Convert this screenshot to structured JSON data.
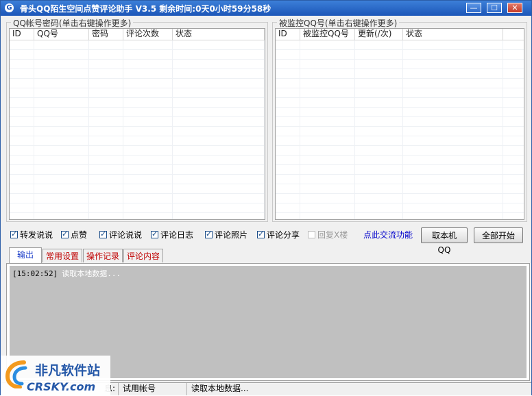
{
  "window": {
    "title": "骨头QQ陌生空间点赞评论助手 V3.5 剩余时间:0天0小时59分58秒",
    "controls": {
      "minimize": "—",
      "maximize": "☐",
      "close": "✕"
    }
  },
  "left_panel": {
    "label": "QQ帐号密码(单击右键操作更多)",
    "columns": [
      "ID",
      "QQ号",
      "密码",
      "评论次数",
      "状态"
    ]
  },
  "right_panel": {
    "label": "被监控QQ号(单击右键操作更多)",
    "columns": [
      "ID",
      "被监控QQ号",
      "更新(/次)",
      "状态"
    ]
  },
  "options": [
    {
      "label": "转发说说",
      "checked": true
    },
    {
      "label": "点赞",
      "checked": true
    },
    {
      "label": "评论说说",
      "checked": true
    },
    {
      "label": "评论日志",
      "checked": true
    },
    {
      "label": "评论照片",
      "checked": true
    },
    {
      "label": "评论分享",
      "checked": true
    },
    {
      "label": "回复X楼",
      "checked": false,
      "disabled": true
    }
  ],
  "link_label": "点此交流功能",
  "buttons": {
    "get_local_qq": "取本机QQ",
    "start_all": "全部开始"
  },
  "tabs": [
    "输出",
    "常用设置",
    "操作记录",
    "评论内容"
  ],
  "log": {
    "timestamp": "[15:02:52]",
    "message": "读取本地数据..."
  },
  "statusbar": {
    "cell1": "息:",
    "account_type": "试用帐号",
    "message": "读取本地数据..."
  },
  "watermark": {
    "cn": "非凡软件站",
    "en": "CRSKY.com"
  }
}
